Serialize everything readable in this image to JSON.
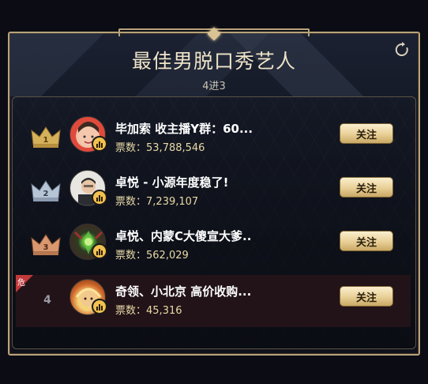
{
  "header": {
    "title": "最佳男脱口秀艺人",
    "subtitle": "4进3"
  },
  "icons": {
    "refresh": "refresh-icon",
    "crown": "crown-icon",
    "mic": "mic-bars-icon",
    "danger": "danger-flag"
  },
  "colors": {
    "gold": "#efe3c8",
    "votes": "#e9d9a6",
    "danger": "#c0393b",
    "crown_gold": "#d6b15b",
    "crown_silver": "#b7c4d6",
    "crown_bronze": "#d99870"
  },
  "list": [
    {
      "rank": "1",
      "name": "毕加索 收主播Y群：60...",
      "votes_label": "票数：",
      "votes": "53,788,546",
      "follow_label": "关注",
      "crown": "gold",
      "danger": false
    },
    {
      "rank": "2",
      "name": "卓悦 - 小源年度稳了!",
      "votes_label": "票数：",
      "votes": "7,239,107",
      "follow_label": "关注",
      "crown": "silver",
      "danger": false
    },
    {
      "rank": "3",
      "name": "卓悦、内蒙C大傻宣大爹..",
      "votes_label": "票数：",
      "votes": "562,029",
      "follow_label": "关注",
      "crown": "bronze",
      "danger": false
    },
    {
      "rank": "4",
      "name": "奇领、小北京 高价收购...",
      "votes_label": "票数：",
      "votes": "45,316",
      "follow_label": "关注",
      "crown": "none",
      "danger": true,
      "danger_label": "危"
    }
  ]
}
